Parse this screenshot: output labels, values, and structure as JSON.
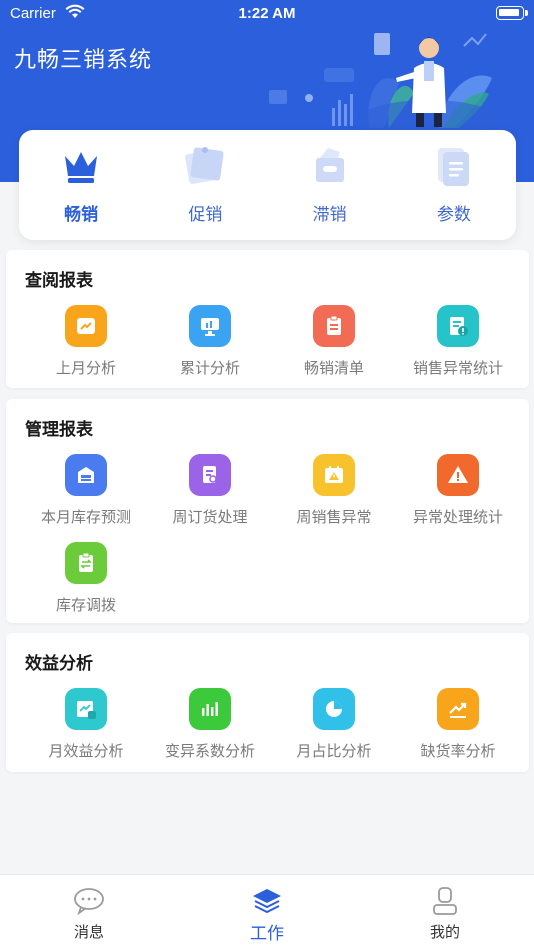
{
  "status_bar": {
    "carrier": "Carrier",
    "time": "1:22 AM"
  },
  "app_title": "九畅三销系统",
  "top_tabs": [
    {
      "label": "畅销",
      "icon": "crown-icon",
      "active": true
    },
    {
      "label": "促销",
      "icon": "promo-tag-icon",
      "active": false
    },
    {
      "label": "滞销",
      "icon": "slow-sale-box-icon",
      "active": false
    },
    {
      "label": "参数",
      "icon": "document-stack-icon",
      "active": false
    }
  ],
  "sections": [
    {
      "title": "查阅报表",
      "items": [
        {
          "label": "上月分析",
          "icon": "trend-chart-icon",
          "color": "#f8a51c"
        },
        {
          "label": "累计分析",
          "icon": "monitor-chart-icon",
          "color": "#3aa4f2"
        },
        {
          "label": "畅销清单",
          "icon": "clipboard-list-icon",
          "color": "#f26b54"
        },
        {
          "label": "销售异常统计",
          "icon": "document-alert-icon",
          "color": "#26c4c9"
        }
      ]
    },
    {
      "title": "管理报表",
      "items": [
        {
          "label": "本月库存预测",
          "icon": "warehouse-icon",
          "color": "#4a7cf0"
        },
        {
          "label": "周订货处理",
          "icon": "order-search-icon",
          "color": "#9b63e8"
        },
        {
          "label": "周销售异常",
          "icon": "calendar-warning-icon",
          "color": "#f7c22b"
        },
        {
          "label": "异常处理统计",
          "icon": "warning-triangle-icon",
          "color": "#f2692d"
        },
        {
          "label": "库存调拨",
          "icon": "transfer-clipboard-icon",
          "color": "#6ccb3a"
        }
      ]
    },
    {
      "title": "效益分析",
      "items": [
        {
          "label": "月效益分析",
          "icon": "monthly-chart-icon",
          "color": "#2ec8cf"
        },
        {
          "label": "变异系数分析",
          "icon": "bar-chart-icon",
          "color": "#3cc93b"
        },
        {
          "label": "月占比分析",
          "icon": "pie-chart-icon",
          "color": "#30c0e8"
        },
        {
          "label": "缺货率分析",
          "icon": "rising-line-icon",
          "color": "#f8a51c"
        }
      ]
    }
  ],
  "tabbar": [
    {
      "label": "消息",
      "icon": "chat-bubble-icon",
      "active": false
    },
    {
      "label": "工作",
      "icon": "layers-icon",
      "active": true
    },
    {
      "label": "我的",
      "icon": "user-icon",
      "active": false
    }
  ],
  "colors": {
    "primary": "#2b5fdc",
    "background": "#f4f5f7"
  }
}
